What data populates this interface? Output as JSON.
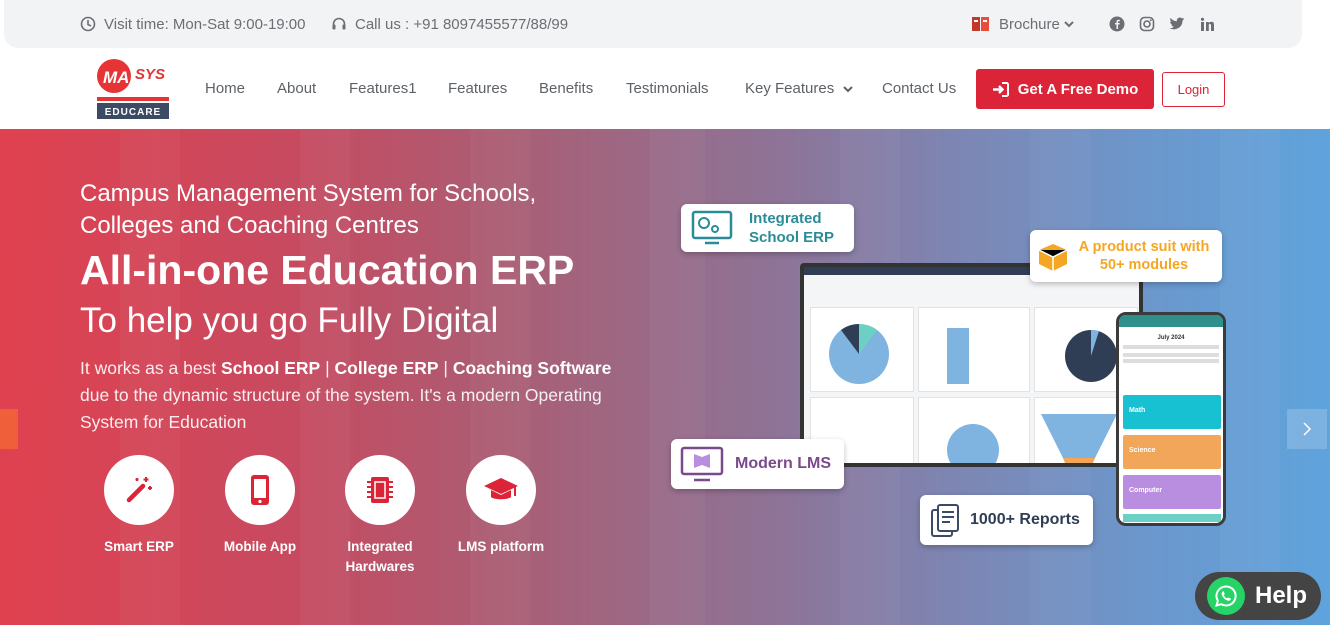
{
  "topbar": {
    "visit_time": "Visit time: Mon-Sat 9:00-19:00",
    "call": "Call us : +91 8097455577/88/99",
    "brochure": "Brochure"
  },
  "logo": {
    "brand_top": "MA SYS",
    "brand_bottom": "EDUCARE"
  },
  "nav": {
    "items": [
      "Home",
      "About",
      "Features1",
      "Features",
      "Benefits",
      "Testimonials",
      "Key Features",
      "Contact Us"
    ],
    "demo_button": "Get A Free Demo",
    "login_button": "Login"
  },
  "hero": {
    "subtitle": "Campus Management System for Schools, Colleges and Coaching Centres",
    "headline": "All-in-one Education ERP",
    "tagline": "To help you go Fully Digital",
    "desc_intro": "It works as a best ",
    "desc_b1": "School ERP",
    "desc_sep1": " | ",
    "desc_b2": "College ERP",
    "desc_sep2": " | ",
    "desc_b3": "Coaching Software",
    "desc_rest": " due to the dynamic structure of the system. It's a modern Operating System for Education",
    "features": [
      {
        "label": "Smart ERP",
        "icon": "magic-wand-icon"
      },
      {
        "label": "Mobile App",
        "icon": "mobile-icon"
      },
      {
        "label": "Integrated Hardwares",
        "icon": "chip-icon"
      },
      {
        "label": "LMS platform",
        "icon": "graduation-cap-icon"
      }
    ],
    "badges": {
      "integrated": "Integrated School ERP",
      "product": "A product suit with 50+ modules",
      "lms": "Modern LMS",
      "reports": "1000+ Reports"
    },
    "phone": {
      "month": "July 2024",
      "classes": [
        "Math",
        "Science",
        "Computer"
      ]
    }
  },
  "help": {
    "label": "Help"
  },
  "colors": {
    "accent": "#db2437",
    "whatsapp": "#25d366"
  }
}
